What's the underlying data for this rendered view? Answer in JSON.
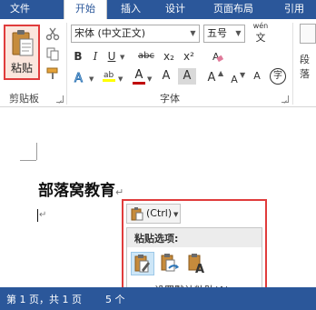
{
  "tabs": [
    {
      "label": "文件",
      "active": false
    },
    {
      "label": "开始",
      "active": true
    },
    {
      "label": "插入",
      "active": false
    },
    {
      "label": "设计",
      "active": false
    },
    {
      "label": "页面布局",
      "active": false
    },
    {
      "label": "引用",
      "active": false
    }
  ],
  "ribbon": {
    "clipboard": {
      "paste_label": "粘贴",
      "group_label": "剪贴板",
      "icons": [
        "paste-icon",
        "cut-icon",
        "copy-icon",
        "format-painter-icon"
      ]
    },
    "font": {
      "font_name": "宋体 (中文正文)",
      "font_size": "五号",
      "phonetic_guide": "wén",
      "bold": "B",
      "italic": "I",
      "underline": "U",
      "strikethrough": "abc",
      "subscript": "x₂",
      "superscript": "x²",
      "font_color_glyph": "A",
      "grow_font": "A",
      "shrink_font": "A",
      "char_shading": "A",
      "enclose_char": "字",
      "group_label": "字体",
      "accent_colors": {
        "highlight": "#ffff00",
        "font_color": "#c00000"
      }
    },
    "paragraph": {
      "group_label_partial": "段落"
    }
  },
  "document": {
    "title": "部落窝教育",
    "paragraph_mark": "↵"
  },
  "paste_options": {
    "button_label": "(Ctrl)",
    "heading": "粘贴选项:",
    "options": [
      "keep-source-formatting",
      "merge-formatting",
      "keep-text-only"
    ],
    "set_default_link": "设置默认粘贴(A)..."
  },
  "status": {
    "page_info": "第 1 页，共 1 页",
    "word_count_partial": "5 个"
  },
  "colors": {
    "brand": "#2b579a",
    "highlight_box": "#e03c3c"
  }
}
